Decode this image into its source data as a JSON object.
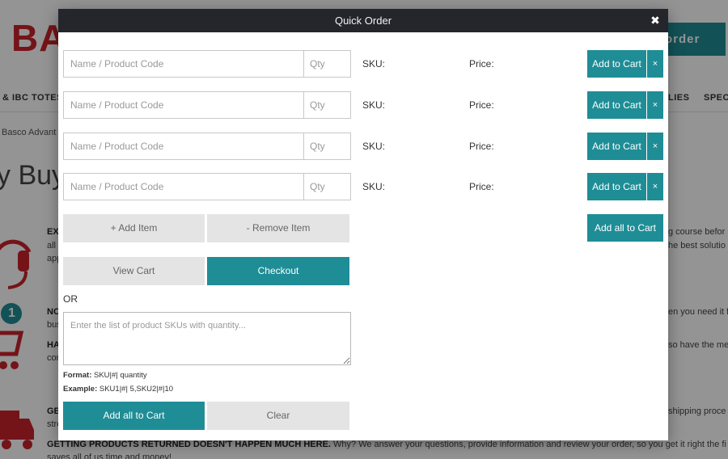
{
  "background": {
    "logo_text": "BA",
    "order_button": "order",
    "nav": [
      "& IBC TOTES",
      "LIES",
      "SPECI"
    ],
    "breadcrumb": "Basco Advant",
    "heading": "y Buy",
    "text_lines": [
      {
        "bold": "EX",
        "text": ""
      },
      {
        "bold": "",
        "text": "all"
      },
      {
        "bold": "",
        "text": "app"
      },
      {
        "bold": "NO",
        "text": ""
      },
      {
        "bold": "",
        "text": "bus"
      },
      {
        "bold": "HA",
        "text": ""
      },
      {
        "bold": "",
        "text": "cor"
      },
      {
        "bold": "GE",
        "text": ""
      },
      {
        "bold": "",
        "text": "stre"
      },
      {
        "bold": "GETTING PRODUCTS RETURNED DOESN'T HAPPEN MUCH HERE.",
        "text": " Why? We answer your questions, provide information and review your order, so you get it right the fi"
      },
      {
        "bold": "",
        "text": "saves all of us time and money!"
      }
    ],
    "right_lines": [
      "g course befor",
      "he best solutio",
      "en you need it f",
      "so have the me",
      "shipping proce"
    ],
    "icon_badge": "1",
    "colors": {
      "brand_red": "#c8232c",
      "teal": "#1f8d96"
    }
  },
  "modal": {
    "title": "Quick Order",
    "close": "✖",
    "rows": [
      {
        "name_placeholder": "Name / Product Code",
        "qty_placeholder": "Qty",
        "sku_label": "SKU:",
        "price_label": "Price:",
        "add_label": "Add to Cart",
        "remove_label": "×"
      },
      {
        "name_placeholder": "Name / Product Code",
        "qty_placeholder": "Qty",
        "sku_label": "SKU:",
        "price_label": "Price:",
        "add_label": "Add to Cart",
        "remove_label": "×"
      },
      {
        "name_placeholder": "Name / Product Code",
        "qty_placeholder": "Qty",
        "sku_label": "SKU:",
        "price_label": "Price:",
        "add_label": "Add to Cart",
        "remove_label": "×"
      },
      {
        "name_placeholder": "Name / Product Code",
        "qty_placeholder": "Qty",
        "sku_label": "SKU:",
        "price_label": "Price:",
        "add_label": "Add to Cart",
        "remove_label": "×"
      }
    ],
    "add_item": "+ Add Item",
    "remove_item": "- Remove Item",
    "add_all_top": "Add all to Cart",
    "view_cart": "View Cart",
    "checkout": "Checkout",
    "or_label": "OR",
    "textarea_placeholder": "Enter the list of product SKUs with quantity...",
    "format_label": "Format:",
    "format_value": " SKU|#| quantity",
    "example_label": "Example:",
    "example_value": " SKU1|#| 5,SKU2|#|10",
    "add_all_bottom": "Add all to Cart",
    "clear": "Clear"
  }
}
